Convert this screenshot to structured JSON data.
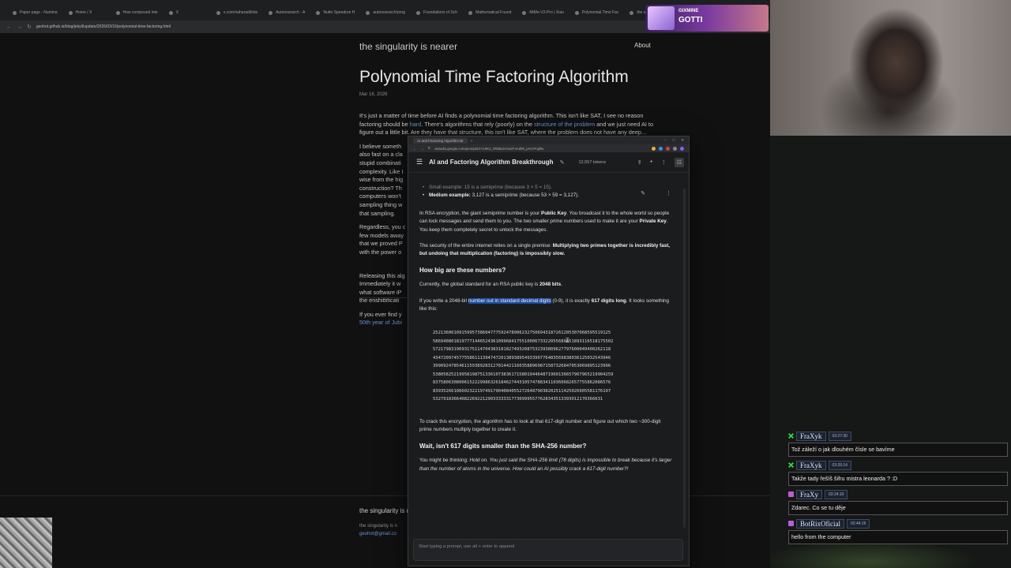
{
  "browser": {
    "tabs": [
      "Paper page - Numina",
      "Home / X",
      "How compound inte",
      "X",
      "x.com/naharadil/sta",
      "Autoresearch - A",
      "Nutto Speedrun H",
      "autoresearch/prog",
      "Foundations of Sch",
      "Mathematical Found",
      "MiMo-V2-Pro | Xiao",
      "Polynomial Time Fac",
      "the singularity is n"
    ],
    "url": "geohot.github.io/blog/jekyll/update/2026/03/16/polynomial-time-factoring.html"
  },
  "blog": {
    "site_title": "the singularity is nearer",
    "about": "About",
    "post_title": "Polynomial Time Factoring Algorithm",
    "date": "Mar 16, 2026",
    "p1_a": "It's just a matter of time before AI finds a polynomial time factoring algorithm. This isn't like SAT, I see no reason factoring should be ",
    "p1_link1": "hard",
    "p1_b": ". There's algorithms that rely (poorly) on the ",
    "p1_link2": "structure of the problem",
    "p1_c": " and we just need AI to figure out a little bit. Are they have that structure, this isn't like SAT, where the problem does not have any deep...",
    "p2_lines": [
      "I believe someth",
      "also fast on a cla",
      "stupid combinati",
      "complexity. Like I",
      "wise from the hig",
      "construction? Th",
      "computers won't",
      "sampling thing w",
      "that sampling."
    ],
    "p3_lines": [
      "Regardless, you c",
      "few models away",
      "that we proved P",
      "with the power o"
    ],
    "p4_lines": [
      "Releasing this alg",
      "Immediately it w",
      "what software iP",
      "the enshittificati"
    ],
    "p5_a": "If you ever find y",
    "p5_link": "50th year of Jubi",
    "footer_title": "the singularity is n",
    "footer_sub": "the singularity is n",
    "footer_mail": "geohot@gmail.co"
  },
  "ai": {
    "tab_label": "AI and Factoring Algorithm Br",
    "url": "aistudio.google.com/prompts/1YL9K2_0R85UiHnaZF4Ad89_pmCPnjd5v",
    "title": "AI and Factoring Algorithm Breakthrough",
    "tokens": "12,557 tokens",
    "bullet1_label": "Small example:",
    "bullet1_text": " 15 is a semiprime (because 3 × 5 = 15).",
    "bullet2_label": "Medium example:",
    "bullet2_text": " 3,127 is a semiprime (because 53 × 59 = 3,127).",
    "para1_a": "In RSA encryption, the giant semiprime number is your ",
    "para1_b1": "Public Key",
    "para1_c": ". You broadcast it to the whole world so people can lock messages and send them to you. The two smaller prime numbers used to make it are your ",
    "para1_b2": "Private Key",
    "para1_d": ". You keep them completely secret to unlock the messages.",
    "para2_a": "The security of the entire internet relies on a single premise: ",
    "para2_b": "Multiplying two primes together is incredibly fast, but undoing that multiplication (factoring) is impossibly slow.",
    "h1": "How big are these numbers?",
    "para3_a": "Currently, the global standard for an RSA public key is ",
    "para3_b": "2048 bits",
    "para3_c": ".",
    "para4_a": "If you write a 2048-bit ",
    "para4_hl": "number out in standard decimal digits",
    "para4_b": " (0-9), it is exactly ",
    "para4_bold": "617 digits long",
    "para4_c": ". It looks something like this:",
    "digits": [
      "25213600109159957386047775924789062327506943187261205307068595519125",
      "58694080181977714465243610996841755100067332205568085189311651817550​2",
      "57217983196931751147043831818274932087532393809627797600049400262118",
      "43472097457755861113947472013893895493390776483569838036125032543946",
      "39909247854611593892831278144211603588969871587326847053069895123996",
      "53805825219958198751336107383617158019446487196013665796796521990425​9",
      "83758063080061522299863261846274431057478834110360682657755862086576",
      "83935266106602322197491790408405527264879038202511425026905581176197",
      "53279183664082269221290333333177309995577628343513393012170366631"
    ],
    "para5": "To crack this encryption, the algorithm has to look at that 617-digit number and figure out which two ~300-digit prime numbers multiply together to create it.",
    "h2": "Wait, isn't 617 digits smaller than the SHA-256 number?",
    "para6_a": "You might be thinking: ",
    "para6_i": "Hold on. You just said the SHA-256 limit (78 digits) is impossible to break because it's larger than the number of atoms in the universe. How could an AI possibly crack a 617-digit number?!",
    "prompt_placeholder": "Start typing a prompt, use alt + enter to append"
  },
  "alert": {
    "small": "GIXMINE",
    "big": "GOTTI"
  },
  "chat": [
    {
      "user": "FraXyk",
      "time": "03:27:30",
      "message": "Tož záleží o jak dlouhém čísle se bavíme",
      "badge_color": "#2bd13a"
    },
    {
      "user": "FraXyk",
      "time": "03:26:14",
      "message": "Takže tady řešíš šifru mistra leonarda ? :D",
      "badge_color": "#2bd13a"
    },
    {
      "user": "FraXy",
      "time": "03:24:10",
      "message": "Zdarec. Co se tu děje",
      "badge_color": "#c15ad8"
    },
    {
      "user": "BotRixOficial",
      "time": "02:44:16",
      "message": "hello from the computer",
      "badge_color": "#c15ad8"
    }
  ]
}
